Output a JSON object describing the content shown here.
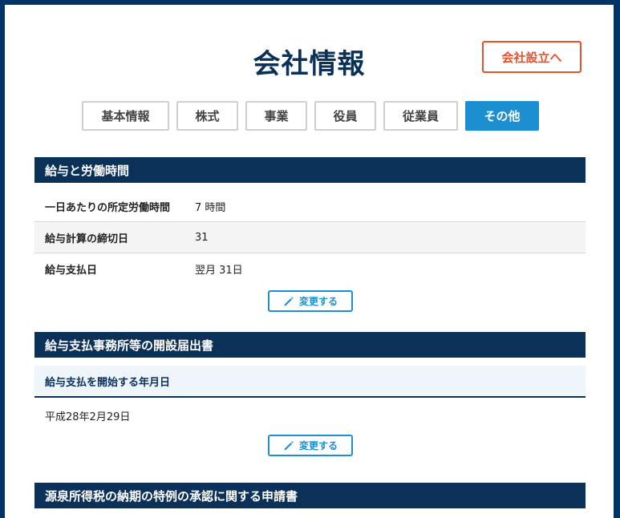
{
  "header": {
    "title": "会社情報",
    "setup_button": "会社設立へ"
  },
  "tabs": [
    {
      "label": "基本情報",
      "active": false
    },
    {
      "label": "株式",
      "active": false
    },
    {
      "label": "事業",
      "active": false
    },
    {
      "label": "役員",
      "active": false
    },
    {
      "label": "従業員",
      "active": false
    },
    {
      "label": "その他",
      "active": true
    }
  ],
  "salary_section": {
    "title": "給与と労働時間",
    "rows": [
      {
        "label": "一日あたりの所定労働時間",
        "value": "7 時間"
      },
      {
        "label": "給与計算の締切日",
        "value": "31"
      },
      {
        "label": "給与支払日",
        "value": "翌月 31日"
      }
    ],
    "edit_label": "変更する"
  },
  "office_section": {
    "title": "給与支払事務所等の開設届出書",
    "field_label": "給与支払を開始する年月日",
    "field_value": "平成28年2月29日",
    "edit_label": "変更する"
  },
  "withholding_section": {
    "title": "源泉所得税の納期の特例の承認に関する申請書"
  },
  "colors": {
    "navy": "#0b3158",
    "accent_blue": "#1b8fcf",
    "setup_red": "#e9502a"
  }
}
